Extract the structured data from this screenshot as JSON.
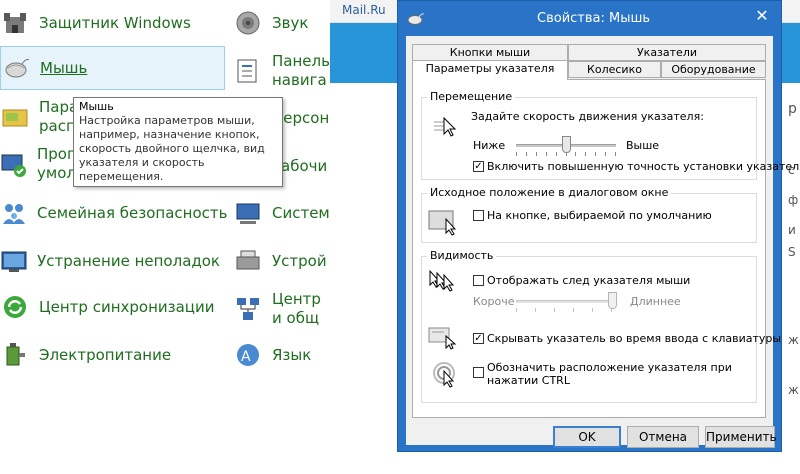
{
  "control_panel": {
    "items": [
      {
        "label": "Защитник Windows",
        "icon": "castle-icon"
      },
      {
        "label": "Звук",
        "icon": "speaker-icon"
      },
      {
        "label": "Мышь",
        "icon": "mouse-icon"
      },
      {
        "label": "Панель навига",
        "icon": "navigation-panel-icon"
      },
      {
        "label": "Парам распо",
        "icon": "folder-options-icon"
      },
      {
        "label": "Персон",
        "icon": "personalization-icon"
      },
      {
        "label": "Прогр умолчанию",
        "icon": "default-programs-icon"
      },
      {
        "label": "Рабочи",
        "icon": "desktop-icon"
      },
      {
        "label": "Семейная безопасность",
        "icon": "family-safety-icon"
      },
      {
        "label": "Систем",
        "icon": "system-icon"
      },
      {
        "label": "Устранение неполадок",
        "icon": "troubleshooting-icon"
      },
      {
        "label": "Устрой",
        "icon": "devices-icon"
      },
      {
        "label": "Центр синхронизации",
        "icon": "sync-center-icon"
      },
      {
        "label": "Центр и общ",
        "icon": "network-center-icon"
      },
      {
        "label": "Электропитание",
        "icon": "power-options-icon"
      },
      {
        "label": "Язык",
        "icon": "language-icon"
      }
    ],
    "tooltip": {
      "title": "Мышь",
      "text": "Настройка параметров мыши, например, назначение кнопок, скорость двойного щелчка, вид указателя и скорость перемещения."
    }
  },
  "browser": {
    "tab_label": "Mail.Ru",
    "right_edge_chars": [
      "р",
      "с",
      "ф",
      "и",
      "S",
      "ж",
      "ж"
    ]
  },
  "dialog": {
    "title": "Свойства: Мышь",
    "close_symbol": "✕",
    "tabs_row1": [
      "Кнопки мыши",
      "Указатели"
    ],
    "tabs_row2": [
      "Параметры указателя",
      "Колесико",
      "Оборудование"
    ],
    "active_tab": "Параметры указателя",
    "motion": {
      "title": "Перемещение",
      "prompt": "Задайте скорость движения указателя:",
      "slow": "Ниже",
      "fast": "Выше",
      "speed_level": 0.5,
      "precision_label": "Включить повышенную точность установки указателя",
      "precision_checked": true
    },
    "snap_to": {
      "title": "Исходное положение в диалоговом окне",
      "label": "На кнопке, выбираемой по умолчанию",
      "checked": false
    },
    "visibility": {
      "title": "Видимость",
      "trails_label": "Отображать след указателя мыши",
      "trails_checked": false,
      "short": "Короче",
      "long": "Длиннее",
      "trails_level": 1.0,
      "hide_label": "Скрывать указатель во время ввода с клавиатуры",
      "hide_checked": true,
      "ctrl_label": "Обозначить расположение указателя при нажатии CTRL",
      "ctrl_checked": false
    },
    "buttons": {
      "ok": "OK",
      "cancel": "Отмена",
      "apply": "Применить"
    },
    "check_symbol": "✓"
  }
}
